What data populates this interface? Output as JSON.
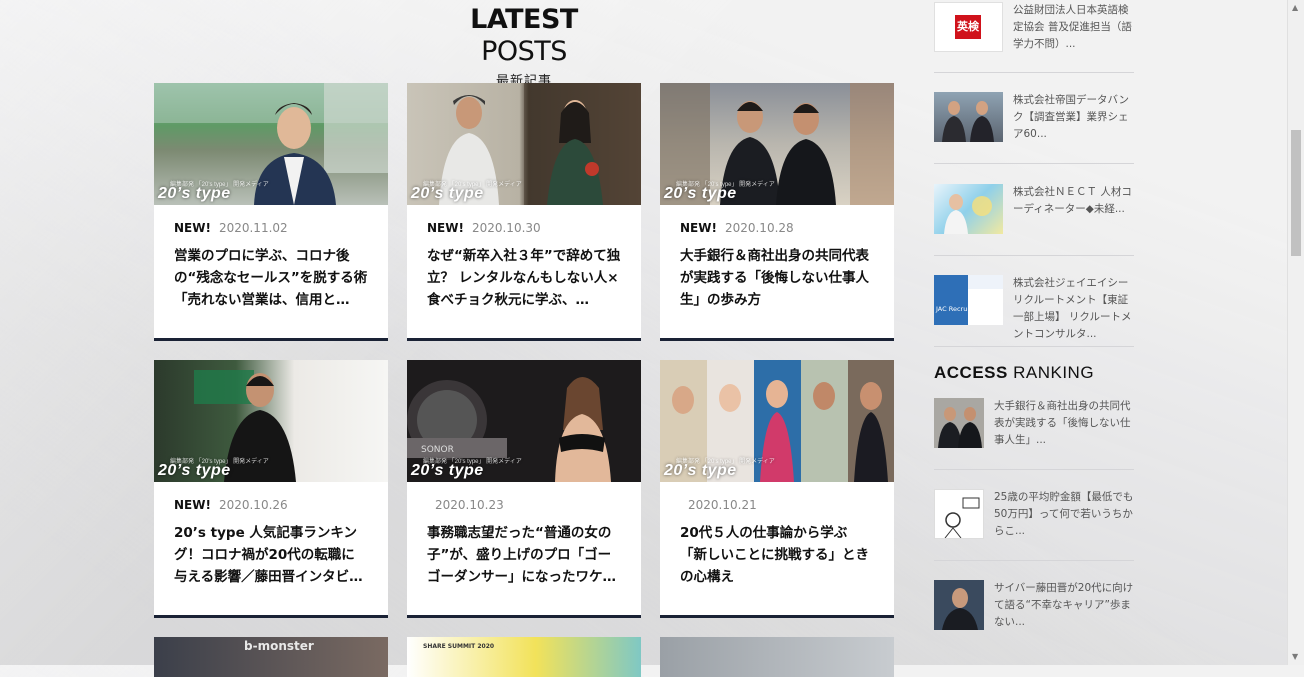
{
  "section": {
    "title_bold": "LATEST",
    "title_light": "POSTS",
    "subtitle": "最新記事"
  },
  "thumbnail_badge": "20’s type",
  "thumbnail_badge_small": "編集部発 「20's type」 開発メディア",
  "posts": [
    {
      "new": "NEW!",
      "date": "2020.11.02",
      "title": "営業のプロに学ぶ、コロナ後の“残念なセールス”を脱する術「売れない営業は、信用と…"
    },
    {
      "new": "NEW!",
      "date": "2020.10.30",
      "title": "なぜ“新卒入社３年”で辞めて独立？ レンタルなんもしない人×食べチョク秋元に学ぶ、…"
    },
    {
      "new": "NEW!",
      "date": "2020.10.28",
      "title": "大手銀行＆商社出身の共同代表が実践する「後悔しない仕事人生」の歩み方"
    },
    {
      "new": "NEW!",
      "date": "2020.10.26",
      "title": "20’s type 人気記事ランキング！コロナ禍が20代の転職に与える影響／藤田晋インタビ…"
    },
    {
      "new": "",
      "date": "2020.10.23",
      "title": "事務職志望だった“普通の女の子”が、盛り上げのプロ「ゴーゴーダンサー」になったワケ…"
    },
    {
      "new": "",
      "date": "2020.10.21",
      "title": "20代５人の仕事論から学ぶ「新しいことに挑戦する」ときの心構え"
    }
  ],
  "bottom_thumbs": [
    "b-monster",
    "SHARE SUMMIT 2020"
  ],
  "sidebar_jobs": [
    {
      "icon_text": "英検",
      "text": "公益財団法人日本英語検定協会 普及促進担当（語学力不問）..."
    },
    {
      "icon_text": "",
      "text": "株式会社帝国データバンク【調査営業】業界シェア60..."
    },
    {
      "icon_text": "",
      "text": "株式会社ＮＥＣＴ 人材コーディネーター◆未経..."
    },
    {
      "icon_text": "JAC Recruitment",
      "text": "株式会社ジェイエイシーリクルートメント【東証一部上場】 リクルートメントコンサルタ..."
    }
  ],
  "ranking": {
    "title_bold": "ACCESS",
    "title_light": "RANKING",
    "items": [
      {
        "text": "大手銀行＆商社出身の共同代表が実践する「後悔しない仕事人生」..."
      },
      {
        "text": "25歳の平均貯金額【最低でも50万円】って何で若いうちからこ..."
      },
      {
        "text": "サイバー藤田晋が20代に向けて語る“不幸なキャリア”歩まない..."
      }
    ]
  },
  "colors": {
    "card_border": "#1a2235",
    "badge_red": "#d0121b"
  }
}
